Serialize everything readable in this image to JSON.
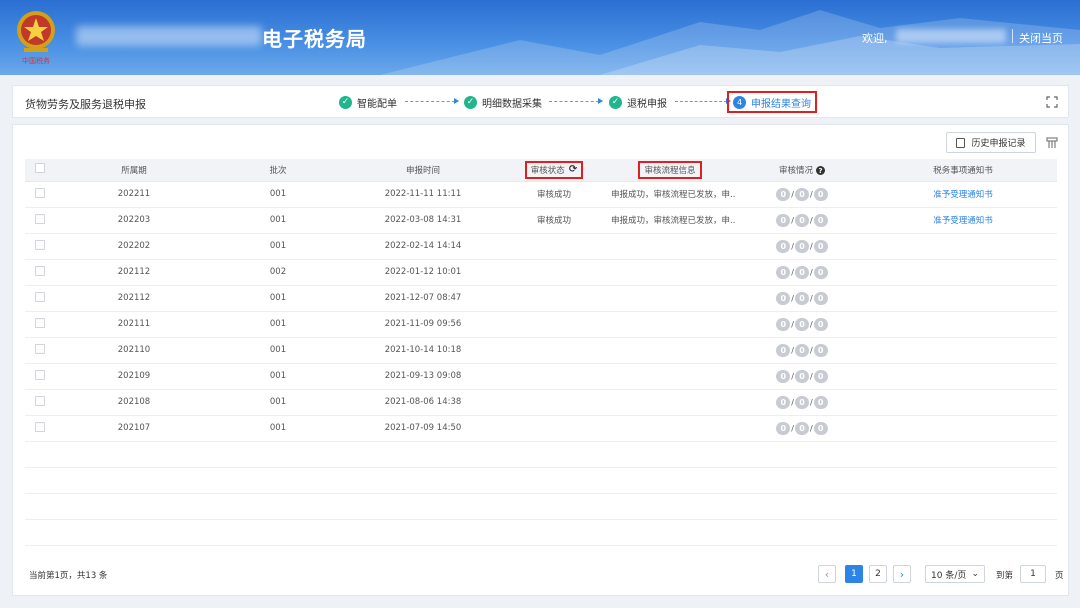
{
  "header": {
    "title": "电子税务局",
    "welcome": "欢迎,",
    "close_page": "关闭当页"
  },
  "steps": {
    "page_title": "货物劳务及服务退税申报",
    "items": [
      {
        "label": "智能配单",
        "state": "done"
      },
      {
        "label": "明细数据采集",
        "state": "done"
      },
      {
        "label": "退税申报",
        "state": "done"
      },
      {
        "label": "申报结果查询",
        "state": "active",
        "number": "4"
      }
    ]
  },
  "toolbar": {
    "history_button": "历史申报记录"
  },
  "table": {
    "headers": [
      "所属期",
      "批次",
      "申报时间",
      "审核状态",
      "审核流程信息",
      "审核情况",
      "税务事项通知书"
    ],
    "rows": [
      {
        "period": "202211",
        "batch": "001",
        "time": "2022-11-11 11:11",
        "status": "审核成功",
        "info": "申报成功，审核流程已发放，申...",
        "notice": "准予受理通知书"
      },
      {
        "period": "202203",
        "batch": "001",
        "time": "2022-03-08 14:31",
        "status": "审核成功",
        "info": "申报成功，审核流程已发放，申...",
        "notice": "准予受理通知书"
      },
      {
        "period": "202202",
        "batch": "001",
        "time": "2022-02-14 14:14",
        "status": "",
        "info": "",
        "notice": ""
      },
      {
        "period": "202112",
        "batch": "002",
        "time": "2022-01-12 10:01",
        "status": "",
        "info": "",
        "notice": ""
      },
      {
        "period": "202112",
        "batch": "001",
        "time": "2021-12-07 08:47",
        "status": "",
        "info": "",
        "notice": ""
      },
      {
        "period": "202111",
        "batch": "001",
        "time": "2021-11-09 09:56",
        "status": "",
        "info": "",
        "notice": ""
      },
      {
        "period": "202110",
        "batch": "001",
        "time": "2021-10-14 10:18",
        "status": "",
        "info": "",
        "notice": ""
      },
      {
        "period": "202109",
        "batch": "001",
        "time": "2021-09-13 09:08",
        "status": "",
        "info": "",
        "notice": ""
      },
      {
        "period": "202108",
        "batch": "001",
        "time": "2021-08-06 14:38",
        "status": "",
        "info": "",
        "notice": ""
      },
      {
        "period": "202107",
        "batch": "001",
        "time": "2021-07-09 14:50",
        "status": "",
        "info": "",
        "notice": ""
      }
    ],
    "review_counts": [
      "0",
      "0",
      "0"
    ]
  },
  "footer": {
    "page_info": "当前第1页，共13 条",
    "pages": [
      "1",
      "2"
    ],
    "page_size": "10 条/页",
    "goto_label": "到第",
    "goto_value": "1",
    "goto_suffix": "页"
  },
  "colors": {
    "accent": "#2c84e6",
    "success": "#20b58c",
    "highlight": "#e02020"
  }
}
